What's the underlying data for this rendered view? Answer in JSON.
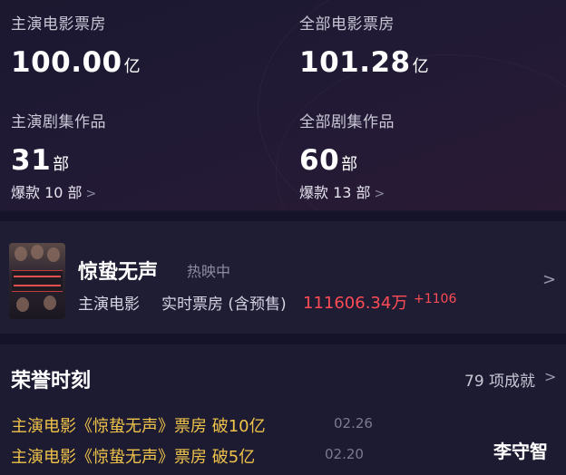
{
  "stats": {
    "movie_box_office": {
      "label": "主演电影票房",
      "value": "100.00",
      "unit": "亿"
    },
    "all_movie_box_office": {
      "label": "全部电影票房",
      "value": "101.28",
      "unit": "亿"
    },
    "lead_series": {
      "label": "主演剧集作品",
      "value": "31",
      "unit": "部",
      "hit": "爆款 10 部"
    },
    "all_series": {
      "label": "全部剧集作品",
      "value": "60",
      "unit": "部",
      "hit": "爆款 13 部"
    }
  },
  "movie": {
    "title": "惊蛰无声",
    "status": "热映中",
    "role": "主演电影",
    "box_office_label": "实时票房 (含预售)",
    "box_office_value": "111606.34万",
    "box_office_increment": "+1106"
  },
  "honor": {
    "title": "荣誉时刻",
    "count": "79 项成就",
    "items": [
      {
        "text": "主演电影《惊蛰无声》票房 破10亿",
        "date": "02.26"
      },
      {
        "text": "主演电影《惊蛰无声》票房 破5亿",
        "date": "02.20"
      }
    ]
  },
  "watermark": "李守智",
  "icons": {
    "chevron": "chevron-right-icon"
  },
  "colors": {
    "accent_red": "#ff4b55",
    "honor_gold": "#f0c34a",
    "background": "#1a1830"
  }
}
